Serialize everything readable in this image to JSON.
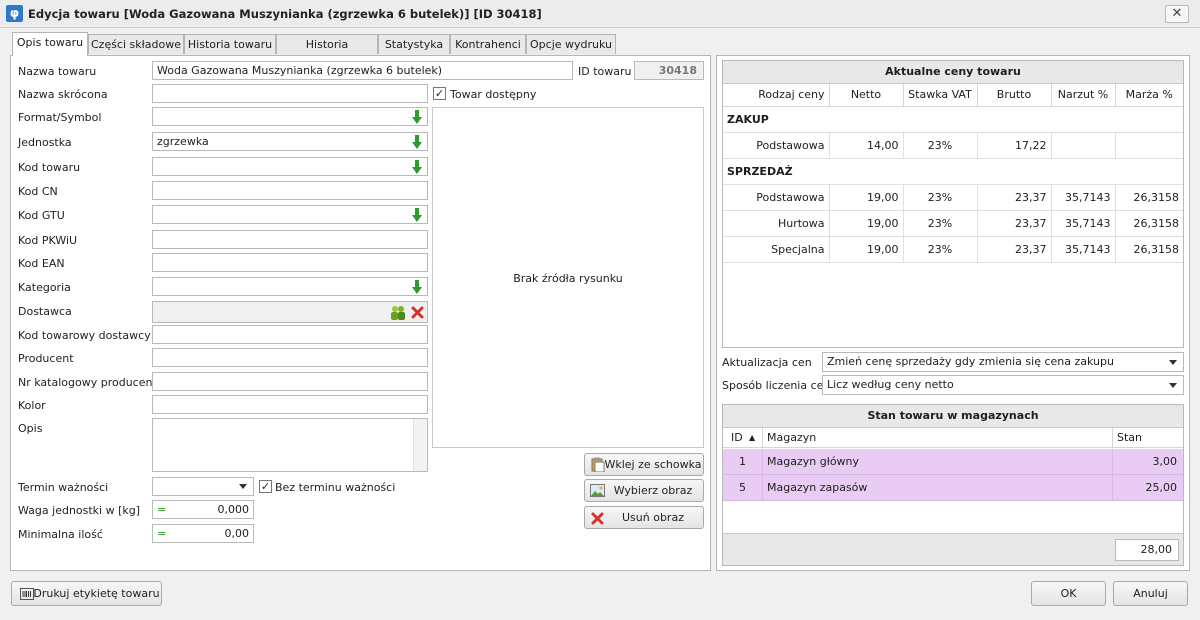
{
  "window": {
    "title": "Edycja towaru [Woda Gazowana Muszynianka (zgrzewka 6 butelek)] [ID 30418]",
    "app_icon": "φ",
    "close_glyph": "✕"
  },
  "tabs": [
    {
      "label": "Opis towaru"
    },
    {
      "label": "Części składowe"
    },
    {
      "label": "Historia towaru"
    },
    {
      "label": "Historia zamówień"
    },
    {
      "label": "Statystyka"
    },
    {
      "label": "Kontrahenci"
    },
    {
      "label": "Opcje wydruku"
    }
  ],
  "form": {
    "nazwa_towaru_label": "Nazwa towaru",
    "nazwa_towaru_value": "Woda Gazowana Muszynianka (zgrzewka 6 butelek)",
    "id_towaru_label": "ID towaru",
    "id_towaru_value": "30418",
    "nazwa_skrocona_label": "Nazwa skrócona",
    "nazwa_skrocona_value": "",
    "towar_dostepny_label": "Towar dostępny",
    "towar_dostepny_checked": "✓",
    "format_label": "Format/Symbol",
    "jednostka_label": "Jednostka",
    "jednostka_value": "zgrzewka",
    "kod_towaru_label": "Kod towaru",
    "kod_cn_label": "Kod CN",
    "kod_gtu_label": "Kod GTU",
    "kod_pkwiu_label": "Kod PKWiU",
    "kod_ean_label": "Kod EAN",
    "kategoria_label": "Kategoria",
    "dostawca_label": "Dostawca",
    "kod_tow_dost_label": "Kod towarowy dostawcy",
    "producent_label": "Producent",
    "nr_katalogowy_label": "Nr katalogowy producenta",
    "kolor_label": "Kolor",
    "opis_label": "Opis",
    "termin_label": "Termin ważności",
    "bez_terminu_label": "Bez terminu ważności",
    "bez_terminu_checked": "✓",
    "waga_label": "Waga jednostki w [kg]",
    "waga_value": "0,000",
    "min_ilosc_label": "Minimalna ilość",
    "min_ilosc_value": "0,00",
    "eq_sign": "="
  },
  "image_area": {
    "placeholder": "Brak źródła rysunku",
    "paste_button": "Wklej ze schowka",
    "choose_button": "Wybierz obraz",
    "remove_button": "Usuń obraz"
  },
  "prices": {
    "title": "Aktualne ceny towaru",
    "headers": [
      "Rodzaj ceny",
      "Netto",
      "Stawka VAT",
      "Brutto",
      "Narzut %",
      "Marża %"
    ],
    "zakup_label": "ZAKUP",
    "sprzedaz_label": "SPRZEDAŻ",
    "zakup_rows": [
      [
        "Podstawowa",
        "14,00",
        "23%",
        "17,22",
        "",
        ""
      ]
    ],
    "sprzedaz_rows": [
      [
        "Podstawowa",
        "19,00",
        "23%",
        "23,37",
        "35,7143",
        "26,3158"
      ],
      [
        "Hurtowa",
        "19,00",
        "23%",
        "23,37",
        "35,7143",
        "26,3158"
      ],
      [
        "Specjalna",
        "19,00",
        "23%",
        "23,37",
        "35,7143",
        "26,3158"
      ]
    ]
  },
  "aktualizacja": {
    "label": "Aktualizacja cen",
    "value": "Zmień cenę sprzedaży gdy zmienia się cena zakupu"
  },
  "sposob": {
    "label": "Sposób liczenia cen",
    "value": "Licz według ceny netto"
  },
  "stock": {
    "title": "Stan towaru w magazynach",
    "headers": [
      "ID",
      "Magazyn",
      "Stan"
    ],
    "sort_glyph": "▲",
    "rows": [
      [
        "1",
        "Magazyn główny",
        "3,00"
      ],
      [
        "5",
        "Magazyn zapasów",
        "25,00"
      ]
    ],
    "total": "28,00",
    "highlight_color": "#e8ccf4"
  },
  "footer": {
    "print_label": "Drukuj etykietę towaru",
    "ok_label": "OK",
    "cancel_label": "Anuluj"
  },
  "colors": {
    "green_arrow": "#2e9b2e",
    "red_x": "#d9302c",
    "accent": "#2b79c7"
  }
}
